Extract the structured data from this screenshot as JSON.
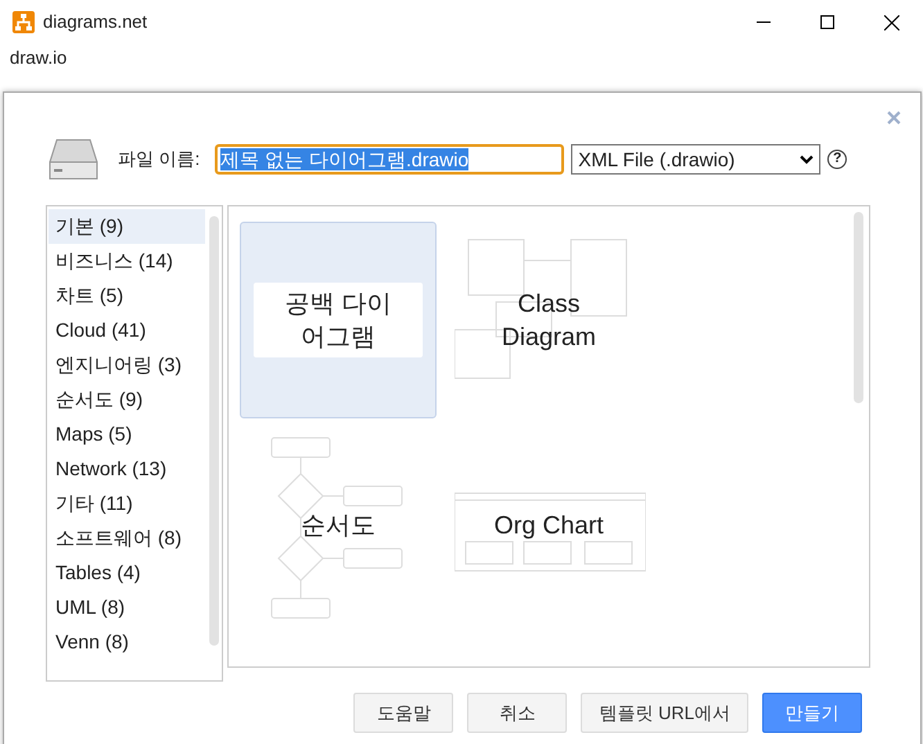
{
  "window": {
    "title": "diagrams.net",
    "subtitle": "draw.io"
  },
  "dialog": {
    "filename_label": "파일 이름:",
    "filename": "제목 없는 다이어그램.drawio",
    "format": "XML File (.drawio)",
    "help": "?"
  },
  "categories": [
    {
      "label": "기본 (9)",
      "selected": true
    },
    {
      "label": "비즈니스 (14)",
      "selected": false
    },
    {
      "label": "차트 (5)",
      "selected": false
    },
    {
      "label": "Cloud (41)",
      "selected": false
    },
    {
      "label": "엔지니어링 (3)",
      "selected": false
    },
    {
      "label": "순서도 (9)",
      "selected": false
    },
    {
      "label": "Maps (5)",
      "selected": false
    },
    {
      "label": "Network (13)",
      "selected": false
    },
    {
      "label": "기타 (11)",
      "selected": false
    },
    {
      "label": "소프트웨어 (8)",
      "selected": false
    },
    {
      "label": "Tables (4)",
      "selected": false
    },
    {
      "label": "UML (8)",
      "selected": false
    },
    {
      "label": "Venn (8)",
      "selected": false
    }
  ],
  "templates": [
    {
      "kind": "blank",
      "label": "공백 다이어그램",
      "selected": true
    },
    {
      "kind": "class",
      "label": "Class Diagram",
      "selected": false
    },
    {
      "kind": "flow",
      "label": "순서도",
      "selected": false
    },
    {
      "kind": "org",
      "label": "Org Chart",
      "selected": false
    }
  ],
  "buttons": [
    {
      "label": "도움말",
      "kind": "plain"
    },
    {
      "label": "취소",
      "kind": "plain"
    },
    {
      "label": "템플릿 URL에서",
      "kind": "plain"
    },
    {
      "label": "만들기",
      "kind": "primary"
    }
  ]
}
